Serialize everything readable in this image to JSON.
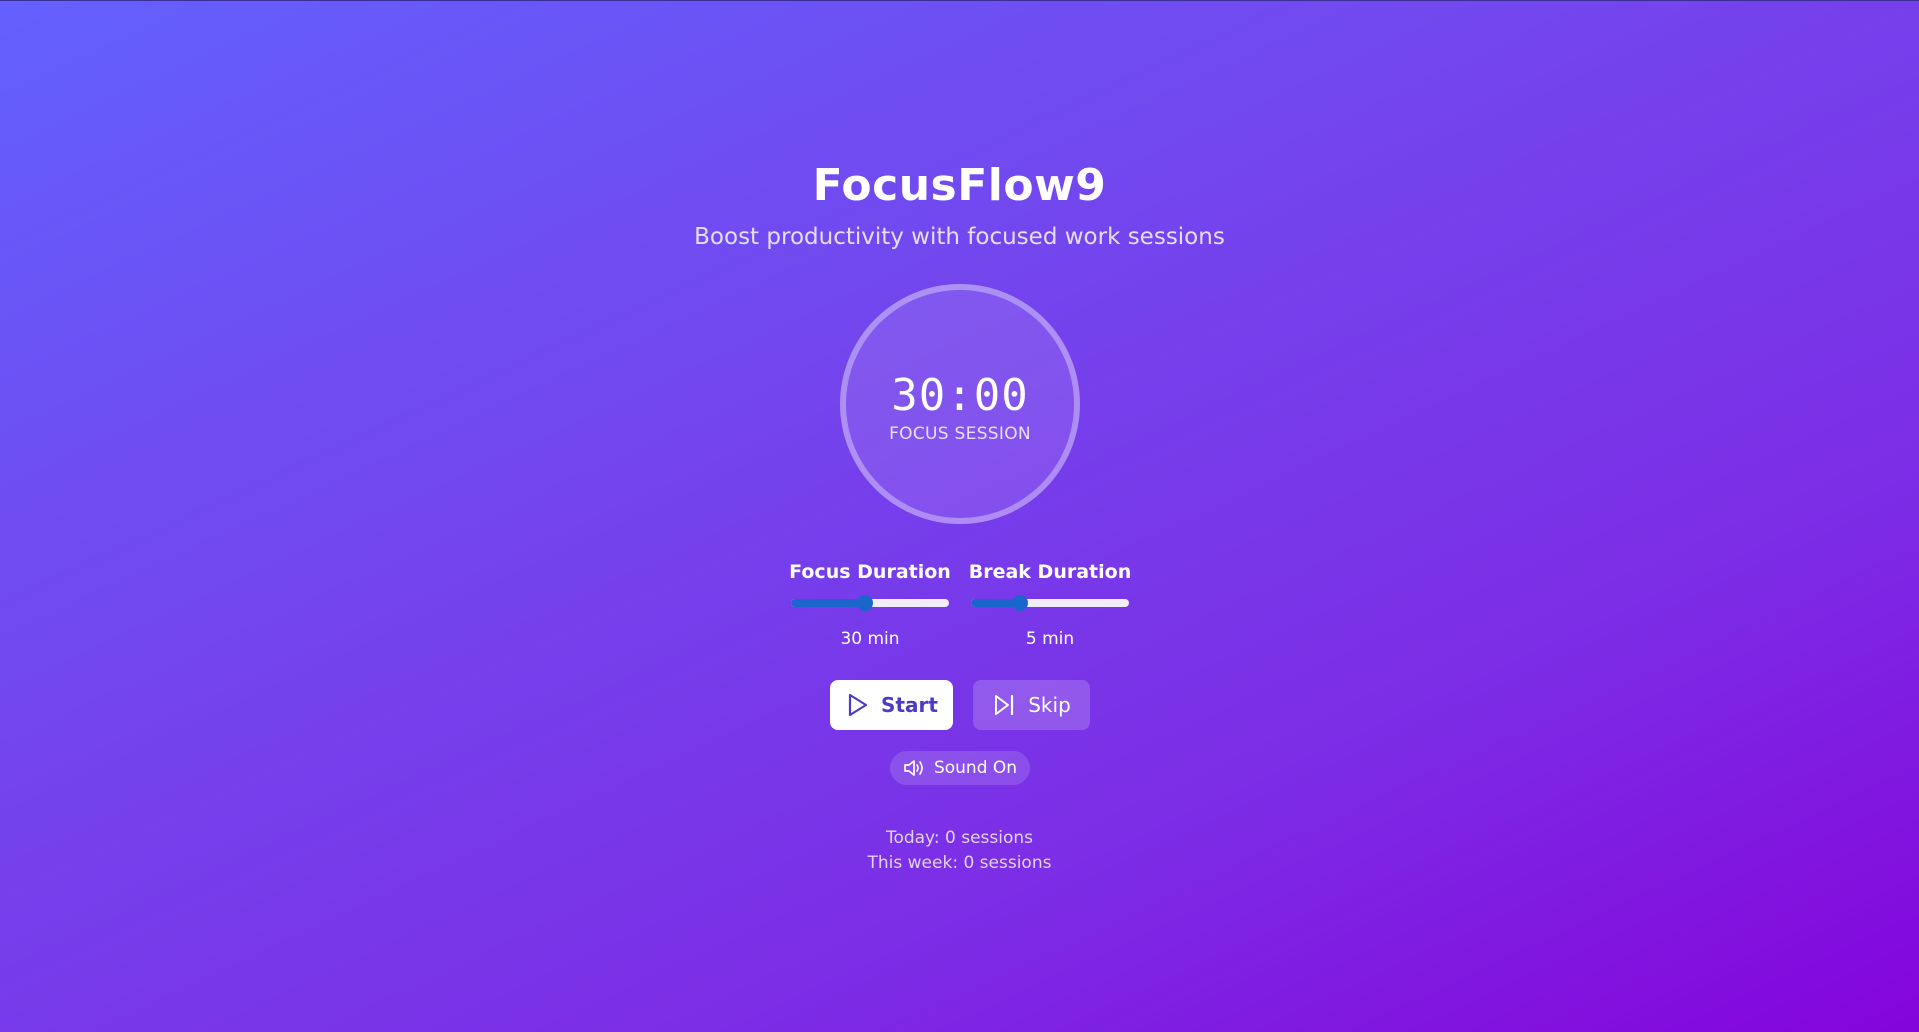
{
  "app": {
    "title": "FocusFlow9",
    "subtitle": "Boost productivity with focused work sessions"
  },
  "timer": {
    "time": "30:00",
    "mode_label": "FOCUS SESSION"
  },
  "settings": {
    "focus": {
      "label": "Focus Duration",
      "value_text": "30 min",
      "value_minutes": 30,
      "slider_fraction": 0.47
    },
    "break": {
      "label": "Break Duration",
      "value_text": "5 min",
      "value_minutes": 5,
      "slider_fraction": 0.31
    }
  },
  "controls": {
    "start_label": "Start",
    "skip_label": "Skip",
    "sound_label": "Sound On"
  },
  "stats": {
    "today": "Today: 0 sessions",
    "week": "This week: 0 sessions"
  },
  "icons": {
    "start": "play-icon",
    "skip": "skip-forward-icon",
    "sound": "speaker-icon"
  },
  "colors": {
    "accent": "#1a66cc",
    "start_text": "#4b3bc9",
    "gradient_start": "#6360fe",
    "gradient_end": "#8404db"
  }
}
